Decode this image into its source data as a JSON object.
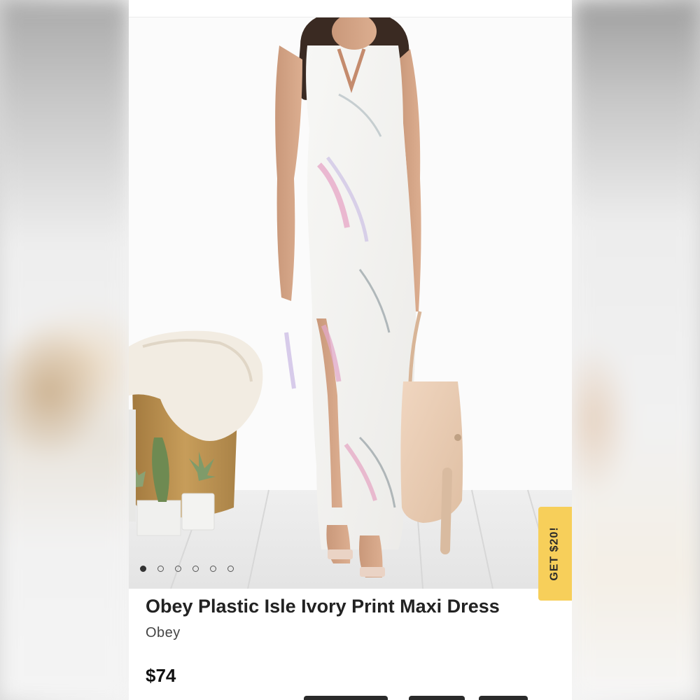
{
  "product": {
    "title": "Obey Plastic Isle Ivory Print Maxi Dress",
    "brand": "Obey",
    "price": "$74",
    "image_alt": "Model wearing ivory print maxi dress with tan tote bag"
  },
  "carousel": {
    "total_images": 6,
    "active_index": 0
  },
  "promo": {
    "label": "GET $20!"
  },
  "colors": {
    "promo_bg": "#f7cf5a",
    "card_bg": "#ffffff",
    "text_primary": "#222222"
  },
  "icons": {
    "carousel_dot": "dot-indicator"
  }
}
